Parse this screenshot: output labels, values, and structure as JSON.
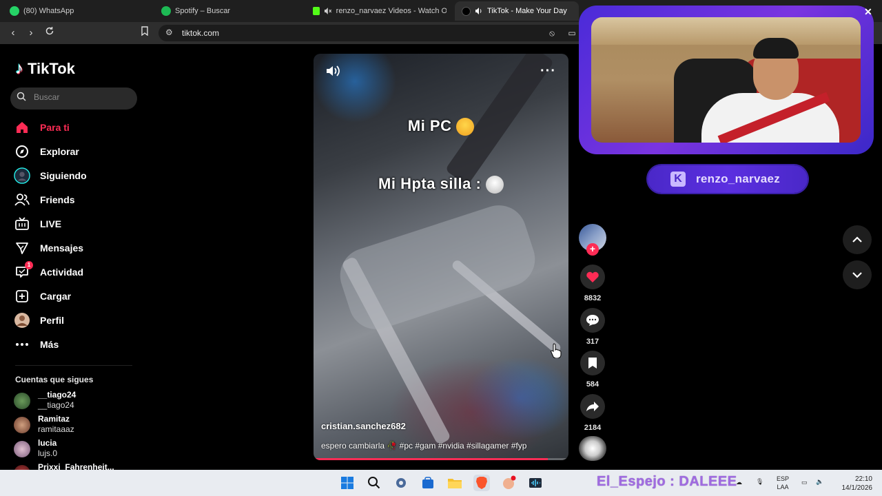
{
  "browser": {
    "tabs": [
      {
        "label": "(80) WhatsApp",
        "icon": "whatsapp-icon",
        "active": false
      },
      {
        "label": "Spotify – Buscar",
        "icon": "spotify-icon",
        "active": false
      },
      {
        "label": "renzo_narvaez Videos - Watch Or",
        "icon": "kick-icon",
        "active": false
      },
      {
        "label": "TikTok - Make Your Day",
        "icon": "tiktok-icon",
        "active": true
      }
    ],
    "url": "tiktok.com"
  },
  "sidebar": {
    "logo": "TikTok",
    "search_placeholder": "Buscar",
    "nav": [
      {
        "label": "Para ti",
        "icon": "home-icon",
        "active": true
      },
      {
        "label": "Explorar",
        "icon": "compass-icon"
      },
      {
        "label": "Siguiendo",
        "icon": "following-avatar-icon"
      },
      {
        "label": "Friends",
        "icon": "friends-icon"
      },
      {
        "label": "LIVE",
        "icon": "live-icon"
      },
      {
        "label": "Mensajes",
        "icon": "send-icon"
      },
      {
        "label": "Actividad",
        "icon": "activity-icon",
        "badge": "1"
      },
      {
        "label": "Cargar",
        "icon": "upload-icon"
      },
      {
        "label": "Perfil",
        "icon": "profile-avatar-icon"
      },
      {
        "label": "Más",
        "icon": "more-icon"
      }
    ],
    "following_title": "Cuentas que sigues",
    "following": [
      {
        "name": "__tiago24",
        "handle": "__tiago24"
      },
      {
        "name": "Ramitaz",
        "handle": "ramitaaaz"
      },
      {
        "name": "lucia",
        "handle": "lujs.0"
      },
      {
        "name": "Prixxi_Fahrenheit...",
        "handle": ""
      }
    ]
  },
  "video": {
    "caption_top": "Mi PC",
    "caption_bottom": "Mi Hpta silla :",
    "username": "cristian.sanchez682",
    "description": "espero cambiarla 🥀 #pc #gam #nvidia #sillagamer #fyp",
    "progress": 0.92
  },
  "actions": {
    "likes": "8832",
    "comments": "317",
    "saves": "584",
    "shares": "2184"
  },
  "stream_overlay": {
    "channel": "renzo_narvaez",
    "chat_message": "El_Espejo : DALEEE"
  },
  "taskbar": {
    "lang_top": "ESP",
    "lang_bottom": "LAA",
    "time": "22:10",
    "date": "14/1/2026"
  },
  "colors": {
    "accent": "#fe2c55",
    "kick_purple": "#5b2fe0"
  }
}
